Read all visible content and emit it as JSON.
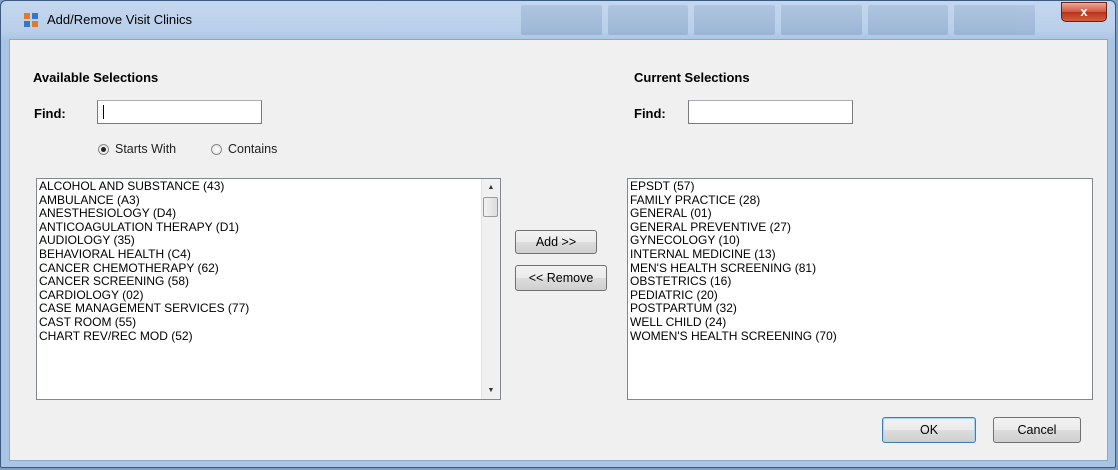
{
  "window": {
    "title": "Add/Remove Visit Clinics",
    "close_label": "x"
  },
  "available": {
    "header": "Available Selections",
    "find_label": "Find:",
    "find_value": "",
    "radio_starts_with": "Starts With",
    "radio_contains": "Contains",
    "selected_mode": "Starts With",
    "items": [
      "ALCOHOL AND SUBSTANCE (43)",
      "AMBULANCE (A3)",
      "ANESTHESIOLOGY (D4)",
      "ANTICOAGULATION THERAPY (D1)",
      "AUDIOLOGY (35)",
      "BEHAVIORAL HEALTH (C4)",
      "CANCER CHEMOTHERAPY (62)",
      "CANCER SCREENING (58)",
      "CARDIOLOGY (02)",
      "CASE MANAGEMENT SERVICES (77)",
      "CAST ROOM (55)",
      "CHART REV/REC MOD (52)"
    ]
  },
  "current": {
    "header": "Current Selections",
    "find_label": "Find:",
    "find_value": "",
    "items": [
      "EPSDT (57)",
      "FAMILY PRACTICE (28)",
      "GENERAL (01)",
      "GENERAL PREVENTIVE (27)",
      "GYNECOLOGY (10)",
      "INTERNAL MEDICINE (13)",
      "MEN'S HEALTH SCREENING (81)",
      "OBSTETRICS (16)",
      "PEDIATRIC (20)",
      "POSTPARTUM (32)",
      "WELL CHILD (24)",
      "WOMEN'S HEALTH SCREENING (70)"
    ]
  },
  "buttons": {
    "add": "Add >>",
    "remove": "<< Remove",
    "ok": "OK",
    "cancel": "Cancel"
  },
  "icons": {
    "scroll_up": "▲",
    "scroll_down": "▼"
  },
  "colors": {
    "title_bar": "#b9cfea",
    "close_button": "#d1543a",
    "client_bg": "#f0f0f0"
  }
}
